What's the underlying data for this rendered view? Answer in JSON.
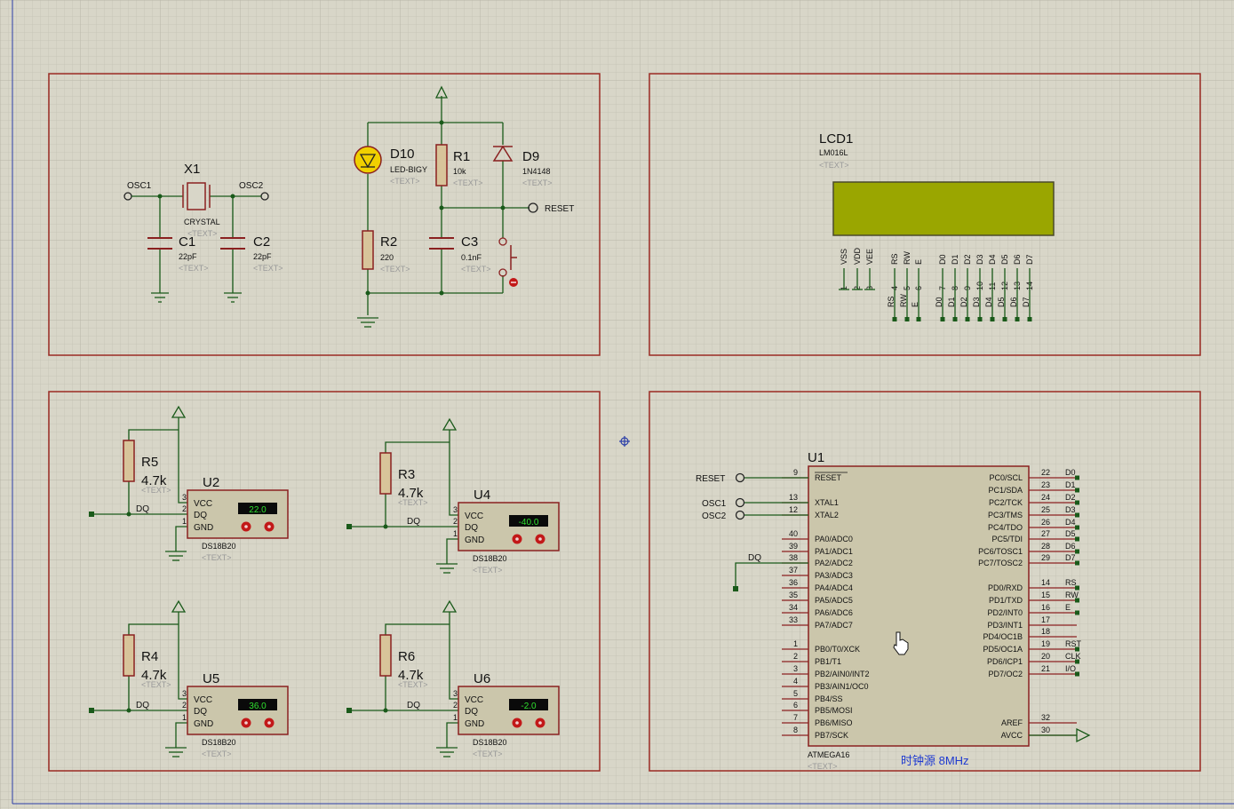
{
  "osc": {
    "osc1": "OSC1",
    "osc2": "OSC2",
    "x1": {
      "ref": "X1",
      "value": "CRYSTAL",
      "text": "<TEXT>"
    },
    "c1": {
      "ref": "C1",
      "value": "22pF",
      "text": "<TEXT>"
    },
    "c2": {
      "ref": "C2",
      "value": "22pF",
      "text": "<TEXT>"
    }
  },
  "reset": {
    "d10": {
      "ref": "D10",
      "value": "LED-BIGY",
      "text": "<TEXT>"
    },
    "r1": {
      "ref": "R1",
      "value": "10k",
      "text": "<TEXT>"
    },
    "d9": {
      "ref": "D9",
      "value": "1N4148",
      "text": "<TEXT>"
    },
    "r2": {
      "ref": "R2",
      "value": "220",
      "text": "<TEXT>"
    },
    "c3": {
      "ref": "C3",
      "value": "0.1nF",
      "text": "<TEXT>"
    },
    "reset_label": "RESET"
  },
  "lcd": {
    "ref": "LCD1",
    "value": "LM016L",
    "text": "<TEXT>",
    "pin_names": [
      "VSS",
      "VDD",
      "VEE",
      "RS",
      "RW",
      "E",
      "D0",
      "D1",
      "D2",
      "D3",
      "D4",
      "D5",
      "D6",
      "D7"
    ],
    "pin_numbers": [
      "1",
      "2",
      "3",
      "4",
      "5",
      "6",
      "7",
      "8",
      "9",
      "10",
      "11",
      "12",
      "13",
      "14"
    ],
    "net_labels": [
      "RS",
      "RW",
      "E",
      "D0",
      "D1",
      "D2",
      "D3",
      "D4",
      "D5",
      "D6",
      "D7"
    ]
  },
  "sensors": [
    {
      "res_ref": "R5",
      "res_val": "4.7k",
      "ref": "U2",
      "reading": "22.0",
      "part": "DS18B20",
      "text": "<TEXT>"
    },
    {
      "res_ref": "R3",
      "res_val": "4.7k",
      "ref": "U4",
      "reading": "-40.0",
      "part": "DS18B20",
      "text": "<TEXT>"
    },
    {
      "res_ref": "R4",
      "res_val": "4.7k",
      "ref": "U5",
      "reading": "36.0",
      "part": "DS18B20",
      "text": "<TEXT>"
    },
    {
      "res_ref": "R6",
      "res_val": "4.7k",
      "ref": "U6",
      "reading": "-2.0",
      "part": "DS18B20",
      "text": "<TEXT>"
    }
  ],
  "sensor_common": {
    "pins": [
      "VCC",
      "DQ",
      "GND"
    ],
    "pin_numbers": [
      "3",
      "2",
      "1"
    ],
    "dq_label": "DQ",
    "res_text": "<TEXT>"
  },
  "mcu": {
    "ref": "U1",
    "part": "ATMEGA16",
    "text": "<TEXT>",
    "clock_note": "时钟源  8MHz",
    "left_pins": [
      {
        "num": "9",
        "name": "RESET"
      },
      {
        "num": "13",
        "name": "XTAL1"
      },
      {
        "num": "12",
        "name": "XTAL2"
      },
      {
        "num": "40",
        "name": "PA0/ADC0"
      },
      {
        "num": "39",
        "name": "PA1/ADC1"
      },
      {
        "num": "38",
        "name": "PA2/ADC2"
      },
      {
        "num": "37",
        "name": "PA3/ADC3"
      },
      {
        "num": "36",
        "name": "PA4/ADC4"
      },
      {
        "num": "35",
        "name": "PA5/ADC5"
      },
      {
        "num": "34",
        "name": "PA6/ADC6"
      },
      {
        "num": "33",
        "name": "PA7/ADC7"
      },
      {
        "num": "1",
        "name": "PB0/T0/XCK"
      },
      {
        "num": "2",
        "name": "PB1/T1"
      },
      {
        "num": "3",
        "name": "PB2/AIN0/INT2"
      },
      {
        "num": "4",
        "name": "PB3/AIN1/OC0"
      },
      {
        "num": "5",
        "name": "PB4/SS"
      },
      {
        "num": "6",
        "name": "PB5/MOSI"
      },
      {
        "num": "7",
        "name": "PB6/MISO"
      },
      {
        "num": "8",
        "name": "PB7/SCK"
      }
    ],
    "right_pins": [
      {
        "num": "22",
        "name": "PC0/SCL",
        "net": "D0"
      },
      {
        "num": "23",
        "name": "PC1/SDA",
        "net": "D1"
      },
      {
        "num": "24",
        "name": "PC2/TCK",
        "net": "D2"
      },
      {
        "num": "25",
        "name": "PC3/TMS",
        "net": "D3"
      },
      {
        "num": "26",
        "name": "PC4/TDO",
        "net": "D4"
      },
      {
        "num": "27",
        "name": "PC5/TDI",
        "net": "D5"
      },
      {
        "num": "28",
        "name": "PC6/TOSC1",
        "net": "D6"
      },
      {
        "num": "29",
        "name": "PC7/TOSC2",
        "net": "D7"
      },
      {
        "num": "14",
        "name": "PD0/RXD",
        "net": "RS"
      },
      {
        "num": "15",
        "name": "PD1/TXD",
        "net": "RW"
      },
      {
        "num": "16",
        "name": "PD2/INT0",
        "net": "E"
      },
      {
        "num": "17",
        "name": "PD3/INT1",
        "net": ""
      },
      {
        "num": "18",
        "name": "PD4/OC1B",
        "net": ""
      },
      {
        "num": "19",
        "name": "PD5/OC1A",
        "net": "RST"
      },
      {
        "num": "20",
        "name": "PD6/ICP1",
        "net": "CLK"
      },
      {
        "num": "21",
        "name": "PD7/OC2",
        "net": "I/O"
      },
      {
        "num": "32",
        "name": "AREF",
        "net": ""
      },
      {
        "num": "30",
        "name": "AVCC",
        "net": ""
      }
    ],
    "net_reset": "RESET",
    "net_osc1": "OSC1",
    "net_osc2": "OSC2",
    "net_dq": "DQ"
  }
}
